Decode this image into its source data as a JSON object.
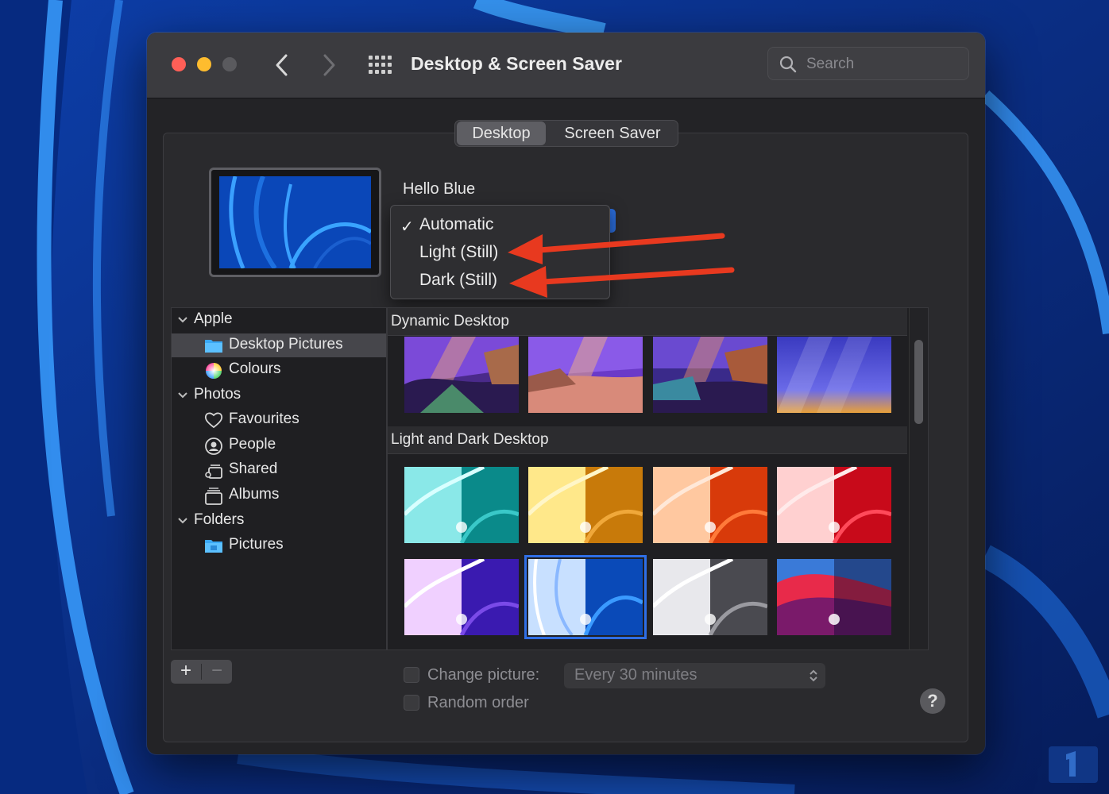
{
  "window": {
    "title": "Desktop & Screen Saver"
  },
  "search": {
    "placeholder": "Search"
  },
  "tabs": [
    {
      "label": "Desktop",
      "selected": true
    },
    {
      "label": "Screen Saver",
      "selected": false
    }
  ],
  "preview": {
    "wallpaper_name": "Hello Blue"
  },
  "appearance_menu": {
    "items": [
      {
        "label": "Automatic",
        "checked": true
      },
      {
        "label": "Light (Still)",
        "checked": false
      },
      {
        "label": "Dark (Still)",
        "checked": false
      }
    ],
    "annotation_color": "#e8391f"
  },
  "sidebar": {
    "groups": [
      {
        "label": "Apple",
        "items": [
          {
            "label": "Desktop Pictures",
            "icon": "folder-icon",
            "selected": true
          },
          {
            "label": "Colours",
            "icon": "color-wheel-icon",
            "selected": false
          }
        ]
      },
      {
        "label": "Photos",
        "items": [
          {
            "label": "Favourites",
            "icon": "heart-icon",
            "selected": false
          },
          {
            "label": "People",
            "icon": "person-icon",
            "selected": false
          },
          {
            "label": "Shared",
            "icon": "shared-album-icon",
            "selected": false
          },
          {
            "label": "Albums",
            "icon": "album-icon",
            "selected": false
          }
        ]
      },
      {
        "label": "Folders",
        "items": [
          {
            "label": "Pictures",
            "icon": "folder-icon",
            "selected": false
          }
        ]
      }
    ]
  },
  "gallery": {
    "sections": [
      {
        "title": "Dynamic Desktop"
      },
      {
        "title": "Light and Dark Desktop"
      }
    ],
    "selected_wallpaper": "Hello Blue"
  },
  "options": {
    "change_picture_label": "Change picture:",
    "change_picture_checked": false,
    "interval": "Every 30 minutes",
    "random_order_label": "Random order",
    "random_order_checked": false
  },
  "buttons": {
    "add": "+",
    "remove": "−",
    "help": "?"
  },
  "colors": {
    "accent": "#2f6fe6",
    "window_bg": "#232326"
  }
}
